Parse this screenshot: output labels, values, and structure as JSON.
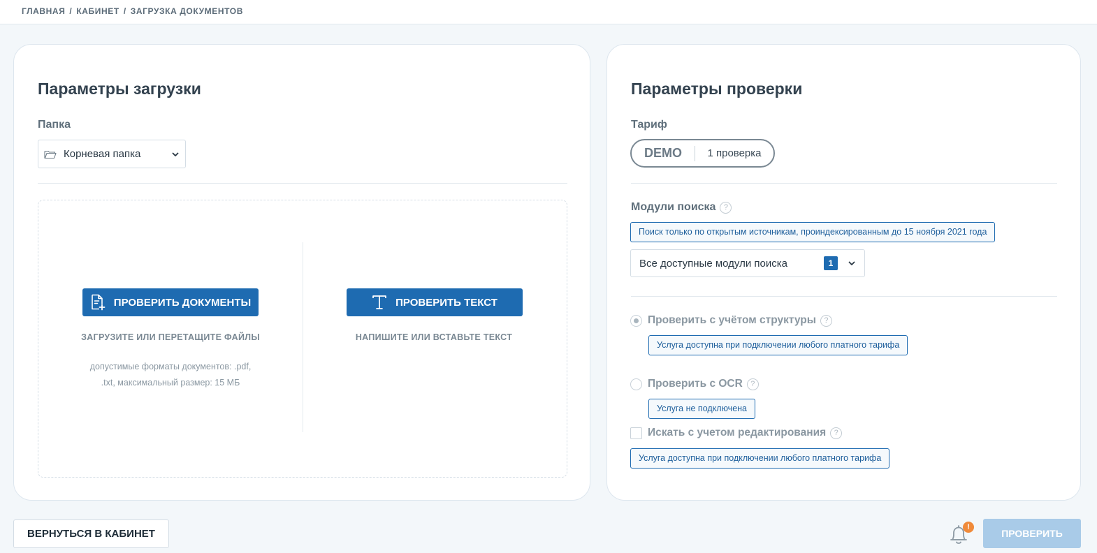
{
  "breadcrumb": {
    "home": "ГЛАВНАЯ",
    "cabinet": "КАБИНЕТ",
    "current": "ЗАГРУЗКА ДОКУМЕНТОВ",
    "separator": "/"
  },
  "upload": {
    "title": "Параметры загрузки",
    "folder_label": "Папка",
    "folder_value": "Корневая папка",
    "check_docs_label": "ПРОВЕРИТЬ ДОКУМЕНТЫ",
    "check_docs_hint": "ЗАГРУЗИТЕ ИЛИ ПЕРЕТАЩИТЕ ФАЙЛЫ",
    "formats_note": "допустимые форматы документов: .pdf, .txt, максимальный размер: 15 МБ",
    "check_text_label": "ПРОВЕРИТЬ ТЕКСТ",
    "check_text_hint": "НАПИШИТЕ ИЛИ ВСТАВЬТЕ ТЕКСТ"
  },
  "check": {
    "title": "Параметры проверки",
    "tariff_label": "Тариф",
    "tariff_name": "DEMO",
    "tariff_count": "1 проверка",
    "modules_label": "Модули поиска",
    "help_glyph": "?",
    "modules_notice": "Поиск только по открытым источникам, проиндексированным до 15 ноября 2021 года",
    "modules_value": "Все доступные модули поиска",
    "modules_count": "1",
    "structure_label": "Проверить с учётом структуры",
    "structure_notice": "Услуга доступна при подключении любого платного тарифа",
    "ocr_label": "Проверить с OCR",
    "ocr_notice": "Услуга не подключена",
    "editing_label": "Искать с учетом редактирования",
    "editing_notice": "Услуга доступна при подключении любого платного тарифа"
  },
  "footer": {
    "back_label": "ВЕРНУТЬСЯ В КАБИНЕТ",
    "alert_glyph": "!",
    "submit_label": "ПРОВЕРИТЬ"
  },
  "colors": {
    "accent": "#1e6bb1",
    "accent_disabled": "#a9cbe8",
    "alert": "#f08a3a"
  },
  "icons": {
    "folder": "folder-icon",
    "chevron": "chevron-down-icon",
    "document_add": "document-add-icon",
    "text": "text-icon",
    "help": "help-icon",
    "bell": "bell-icon"
  }
}
